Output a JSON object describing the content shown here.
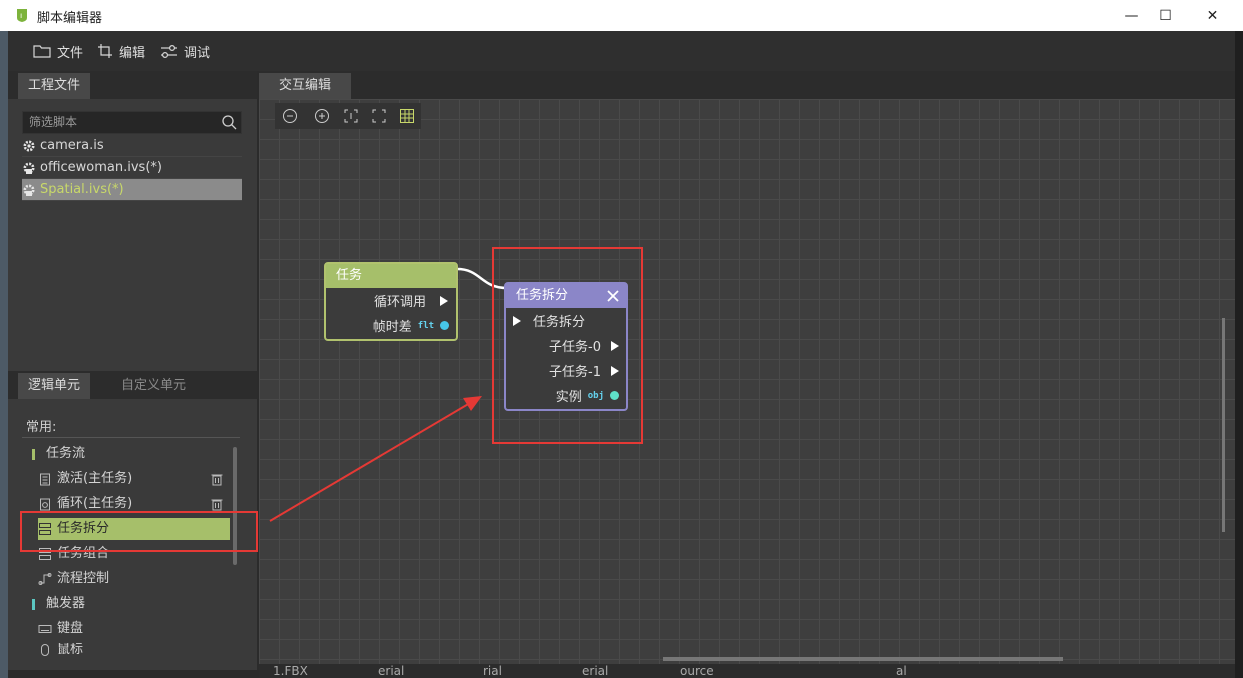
{
  "window": {
    "title": "脚本编辑器",
    "minimize": "—",
    "maximize": "☐",
    "close": "✕"
  },
  "toolbar": {
    "file": "文件",
    "edit": "编辑",
    "debug": "调试"
  },
  "project_panel": {
    "tab": "工程文件",
    "filter_placeholder": "筛选脚本",
    "files": [
      {
        "name": "camera.is",
        "selected": false
      },
      {
        "name": "officewoman.ivs(*)",
        "selected": false
      },
      {
        "name": "Spatial.ivs(*)",
        "selected": true
      }
    ]
  },
  "units_panel": {
    "tab_logic": "逻辑单元",
    "tab_custom": "自定义单元",
    "section": "常用:",
    "items": [
      {
        "label": "任务流",
        "kind": "group"
      },
      {
        "label": "激活(主任务)",
        "kind": "item"
      },
      {
        "label": "循环(主任务)",
        "kind": "item"
      },
      {
        "label": "任务拆分",
        "kind": "item",
        "selected": true
      },
      {
        "label": "任务组合",
        "kind": "item"
      },
      {
        "label": "流程控制",
        "kind": "item"
      },
      {
        "label": "触发器",
        "kind": "group"
      },
      {
        "label": "键盘",
        "kind": "item"
      },
      {
        "label": "鼠标",
        "kind": "item"
      }
    ]
  },
  "canvas": {
    "tab": "交互编辑",
    "node_task": {
      "title": "任务",
      "out_exec": "循环调用",
      "out_value": "帧时差",
      "out_value_type": "flt"
    },
    "node_split": {
      "title": "任务拆分",
      "in_exec": "任务拆分",
      "out_0": "子任务-0",
      "out_1": "子任务-1",
      "out_value": "实例",
      "out_value_type": "obj"
    },
    "bottom_labels": [
      "1.FBX",
      "erial",
      "rial",
      "erial",
      "ource",
      "al"
    ]
  },
  "colors": {
    "task_node": "#a6bf6a",
    "split_node": "#8b86c8",
    "annotation": "#e53935"
  }
}
